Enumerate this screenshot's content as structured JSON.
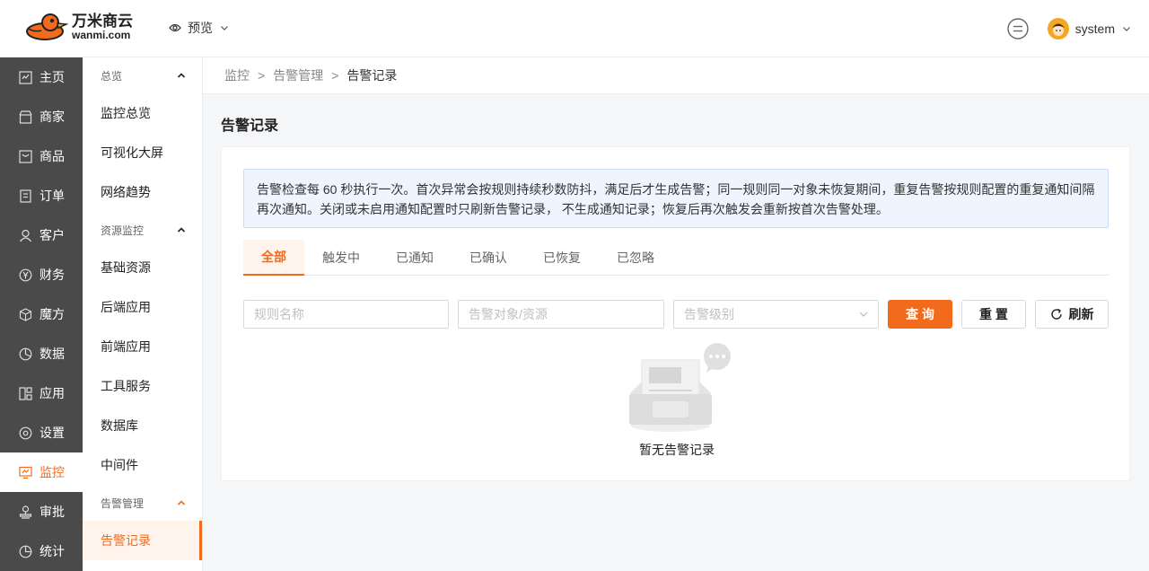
{
  "header": {
    "logo_cn": "万米商云",
    "logo_en": "wanmi.com",
    "preview_label": "预览",
    "user_name": "system"
  },
  "sidebar": {
    "items": [
      {
        "label": "主页",
        "icon": "home-icon"
      },
      {
        "label": "商家",
        "icon": "shop-icon"
      },
      {
        "label": "商品",
        "icon": "goods-icon"
      },
      {
        "label": "订单",
        "icon": "order-icon"
      },
      {
        "label": "客户",
        "icon": "customer-icon"
      },
      {
        "label": "财务",
        "icon": "finance-icon"
      },
      {
        "label": "魔方",
        "icon": "cube-icon"
      },
      {
        "label": "数据",
        "icon": "data-icon"
      },
      {
        "label": "应用",
        "icon": "app-icon"
      },
      {
        "label": "设置",
        "icon": "settings-icon"
      },
      {
        "label": "监控",
        "icon": "monitor-icon"
      },
      {
        "label": "审批",
        "icon": "approve-icon"
      },
      {
        "label": "统计",
        "icon": "stats-icon"
      }
    ],
    "active": "监控"
  },
  "subnav": {
    "group_overview": "总览",
    "overview_items": [
      "监控总览",
      "可视化大屏",
      "网络趋势"
    ],
    "group_resource": "资源监控",
    "resource_items": [
      "基础资源",
      "后端应用",
      "前端应用",
      "工具服务",
      "数据库",
      "中间件"
    ],
    "group_alert": "告警管理",
    "alert_items": [
      "告警记录"
    ]
  },
  "breadcrumb": {
    "level1": "监控",
    "level2": "告警管理",
    "level3": "告警记录",
    "separator": ">"
  },
  "page": {
    "title": "告警记录",
    "notice": "告警检查每 60 秒执行一次。首次异常会按规则持续秒数防抖，满足后才生成告警；同一规则同一对象未恢复期间，重复告警按规则配置的重复通知间隔再次通知。关闭或未启用通知配置时只刷新告警记录， 不生成通知记录；恢复后再次触发会重新按首次告警处理。"
  },
  "tabs": [
    {
      "label": "全部",
      "active": true
    },
    {
      "label": "触发中",
      "active": false
    },
    {
      "label": "已通知",
      "active": false
    },
    {
      "label": "已确认",
      "active": false
    },
    {
      "label": "已恢复",
      "active": false
    },
    {
      "label": "已忽略",
      "active": false
    }
  ],
  "filters": {
    "rule_name_placeholder": "规则名称",
    "target_placeholder": "告警对象/资源",
    "level_placeholder": "告警级别",
    "query_label": "查 询",
    "reset_label": "重 置",
    "refresh_label": "刷新"
  },
  "empty": {
    "text": "暂无告警记录"
  },
  "colors": {
    "accent": "#f26b1d",
    "sidebar_bg": "#4a4a4a",
    "notice_bg": "#eef5ff"
  }
}
